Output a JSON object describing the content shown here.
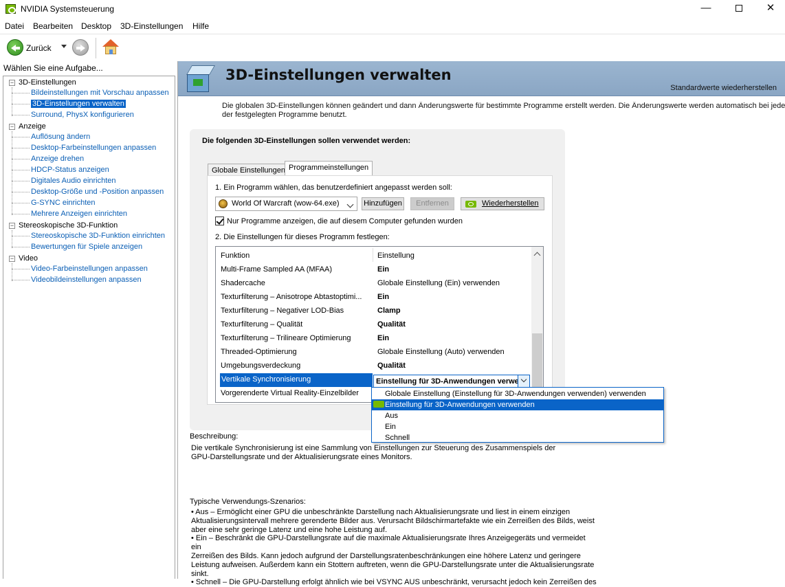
{
  "window": {
    "title": "NVIDIA Systemsteuerung",
    "minimize": "—",
    "close": "✕"
  },
  "menu": [
    "Datei",
    "Bearbeiten",
    "Desktop",
    "3D-Einstellungen",
    "Hilfe"
  ],
  "toolbar": {
    "back_label": "Zurück"
  },
  "sidebar": {
    "header": "Wählen Sie eine Aufgabe...",
    "categories": [
      {
        "label": "3D-Einstellungen",
        "toggle": "−",
        "items": [
          "Bildeinstellungen mit Vorschau anpassen",
          "3D-Einstellungen verwalten",
          "Surround, PhysX konfigurieren"
        ]
      },
      {
        "label": "Anzeige",
        "toggle": "−",
        "items": [
          "Auflösung ändern",
          "Desktop-Farbeinstellungen anpassen",
          "Anzeige drehen",
          "HDCP-Status anzeigen",
          "Digitales Audio einrichten",
          "Desktop-Größe und -Position anpassen",
          "G-SYNC einrichten",
          "Mehrere Anzeigen einrichten"
        ]
      },
      {
        "label": "Stereoskopische 3D-Funktion",
        "toggle": "−",
        "items": [
          "Stereoskopische 3D-Funktion einrichten",
          "Bewertungen für Spiele anzeigen"
        ]
      },
      {
        "label": "Video",
        "toggle": "−",
        "items": [
          "Video-Farbeinstellungen anpassen",
          "Videobildeinstellungen anpassen"
        ]
      }
    ],
    "selected": "3D-Einstellungen verwalten"
  },
  "banner": {
    "title": "3D-Einstellungen verwalten",
    "restore_defaults": "Standardwerte wiederherstellen"
  },
  "intro": {
    "line1": "Die globalen 3D-Einstellungen können geändert und dann Änderungswerte für bestimmte Programme erstellt werden. Die Änderungswerte werden automatisch bei jedem Start",
    "line2": "der festgelegten Programme benutzt."
  },
  "group": {
    "title": "Die folgenden 3D-Einstellungen sollen verwendet werden:",
    "tabs": [
      "Globale Einstellungen",
      "Programmeinstellungen"
    ],
    "active_tab": "Programmeinstellungen",
    "step1": "1. Ein Programm wählen, das benutzerdefiniert angepasst werden soll:",
    "program": "World Of Warcraft (wow-64.exe)",
    "add_button": "Hinzufügen",
    "remove_button": "Entfernen",
    "restore_button": "Wiederherstellen",
    "checkbox_label": "Nur Programme anzeigen, die auf diesem Computer gefunden wurden",
    "checkbox_checked": true,
    "step2": "2. Die Einstellungen für dieses Programm festlegen:"
  },
  "grid": {
    "headers": {
      "function": "Funktion",
      "setting": "Einstellung"
    },
    "rows": [
      {
        "function": "Multi-Frame Sampled AA (MFAA)",
        "setting": "Ein",
        "bold": true
      },
      {
        "function": "Shadercache",
        "setting": "Globale Einstellung (Ein) verwenden",
        "bold": false
      },
      {
        "function": "Texturfilterung – Anisotrope Abtastoptimi...",
        "setting": "Ein",
        "bold": true
      },
      {
        "function": "Texturfilterung – Negativer LOD-Bias",
        "setting": "Clamp",
        "bold": true
      },
      {
        "function": "Texturfilterung – Qualität",
        "setting": "Qualität",
        "bold": true
      },
      {
        "function": "Texturfilterung – Trilineare Optimierung",
        "setting": "Ein",
        "bold": true
      },
      {
        "function": "Threaded-Optimierung",
        "setting": "Globale Einstellung (Auto) verwenden",
        "bold": false
      },
      {
        "function": "Umgebungsverdeckung",
        "setting": "Qualität",
        "bold": true
      },
      {
        "function": "Vertikale Synchronisierung",
        "setting": "Einstellung für 3D-Anwendungen verwenden",
        "bold": true,
        "selected": true
      },
      {
        "function": "Vorgerenderte Virtual Reality-Einzelbilder",
        "setting": "",
        "bold": false
      }
    ]
  },
  "dropdown": {
    "options": [
      "Globale Einstellung (Einstellung für 3D-Anwendungen verwenden) verwenden",
      "Einstellung für 3D-Anwendungen verwenden",
      "Aus",
      "Ein",
      "Schnell"
    ],
    "highlighted": "Einstellung für 3D-Anwendungen verwenden"
  },
  "description": {
    "label": "Beschreibung:",
    "text1": "Die vertikale Synchronisierung ist eine Sammlung von Einstellungen zur Steuerung des Zusammenspiels der",
    "text2": "GPU-Darstellungsrate und der Aktualisierungsrate eines Monitors."
  },
  "usage": {
    "title": "Typische Verwendungs-Szenarios:",
    "lines": [
      "• Aus – Ermöglicht einer GPU die unbeschränkte Darstellung nach Aktualisierungsrate und liest in einem einzigen",
      "Aktualisierungsintervall mehrere gerenderte Bilder aus. Verursacht Bildschirmartefakte wie ein Zerreißen des Bilds, weist",
      "aber eine sehr geringe Latenz und eine hohe Leistung auf.",
      "• Ein – Beschränkt die GPU-Darstellungsrate auf die maximale Aktualisierungsrate Ihres Anzeigegeräts und vermeidet ein",
      "Zerreißen des Bilds. Kann jedoch aufgrund der Darstellungsratenbeschränkungen eine höhere Latenz und geringere",
      "Leistung aufweisen. Außerdem kann ein Stottern auftreten, wenn die GPU-Darstellungsrate unter die Aktualisierungsrate",
      "sinkt.",
      "• Schnell – Die GPU-Darstellung erfolgt ähnlich wie bei VSYNC AUS unbeschränkt, verursacht jedoch kein Zerreißen des"
    ]
  }
}
